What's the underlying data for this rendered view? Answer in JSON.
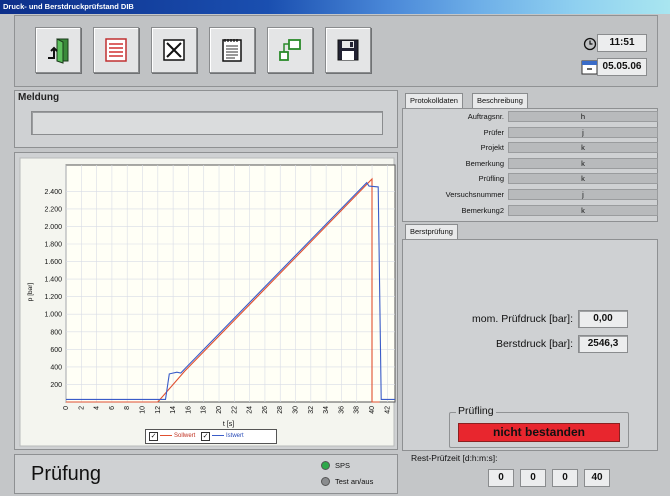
{
  "window": {
    "title": "Druck- und Berstdruckprüfstand DIB"
  },
  "toolbar": {
    "buttons": [
      {
        "name": "exit-button",
        "icon": "exit-door-icon"
      },
      {
        "name": "list-button",
        "icon": "list-icon"
      },
      {
        "name": "cancel-button",
        "icon": "cross-box-icon"
      },
      {
        "name": "notes-button",
        "icon": "notepad-icon"
      },
      {
        "name": "connect-button",
        "icon": "connect-icon"
      },
      {
        "name": "save-button",
        "icon": "floppy-disk-icon"
      }
    ],
    "time": "11:51",
    "date": "05.05.06"
  },
  "meldung": {
    "title": "Meldung",
    "text": ""
  },
  "chart_data": {
    "type": "line",
    "xlabel": "t [s]",
    "ylabel": "p [bar]",
    "xlim": [
      0,
      43
    ],
    "ylim": [
      0,
      2700
    ],
    "xticks": [
      "0",
      "2",
      "4",
      "6",
      "8",
      "10",
      "12",
      "14",
      "16",
      "18",
      "20",
      "22",
      "24",
      "26",
      "28",
      "30",
      "32",
      "34",
      "36",
      "38",
      "40",
      "42"
    ],
    "yticks": [
      "200",
      "400",
      "600",
      "800",
      "1.000",
      "1.200",
      "1.400",
      "1.600",
      "1.800",
      "2.000",
      "2.200",
      "2.400"
    ],
    "grid": true,
    "legend_position": "bottom-center",
    "series": [
      {
        "name": "Sollwert",
        "color": "#e05030",
        "x": [
          0,
          12,
          15.5,
          40,
          40,
          41
        ],
        "y": [
          0,
          0,
          350,
          2540,
          0,
          0
        ]
      },
      {
        "name": "Istwert",
        "color": "#3a5cc8",
        "x": [
          0,
          13,
          13.5,
          14.5,
          15,
          16,
          39.3,
          39.6,
          40.8,
          41.2,
          43
        ],
        "y": [
          30,
          30,
          320,
          340,
          330,
          420,
          2500,
          2460,
          2450,
          30,
          30
        ]
      }
    ]
  },
  "footer": {
    "title": "Prüfung",
    "sps_label": "SPS",
    "test_label": "Test an/aus",
    "sps_color": "#2ea84a",
    "test_color": "#8a8c8e"
  },
  "protokoll": {
    "tabs": [
      "Protokolldaten",
      "Beschreibung"
    ],
    "rows": [
      {
        "label": "Auftragsnr.",
        "value": "h"
      },
      {
        "label": "Prüfer",
        "value": "j"
      },
      {
        "label": "Projekt",
        "value": "k"
      },
      {
        "label": "Bemerkung",
        "value": "k"
      },
      {
        "label": "Prüfling",
        "value": "k"
      },
      {
        "label": "Versuchsnummer",
        "value": "j"
      },
      {
        "label": "Bemerkung2",
        "value": "k"
      }
    ]
  },
  "berst": {
    "tab": "Berstprüfung",
    "pruefdruck_label": "mom. Prüfdruck [bar]:",
    "pruefdruck_value": "0,00",
    "berstdruck_label": "Berstdruck [bar]:",
    "berstdruck_value": "2546,3",
    "pruefling_label": "Prüfling",
    "pruefling_status": "nicht bestanden",
    "status_color": "#e8262e",
    "rest_label": "Rest-Prüfzeit [d:h:m:s]:",
    "rest_values": [
      "0",
      "0",
      "0",
      "40"
    ]
  }
}
